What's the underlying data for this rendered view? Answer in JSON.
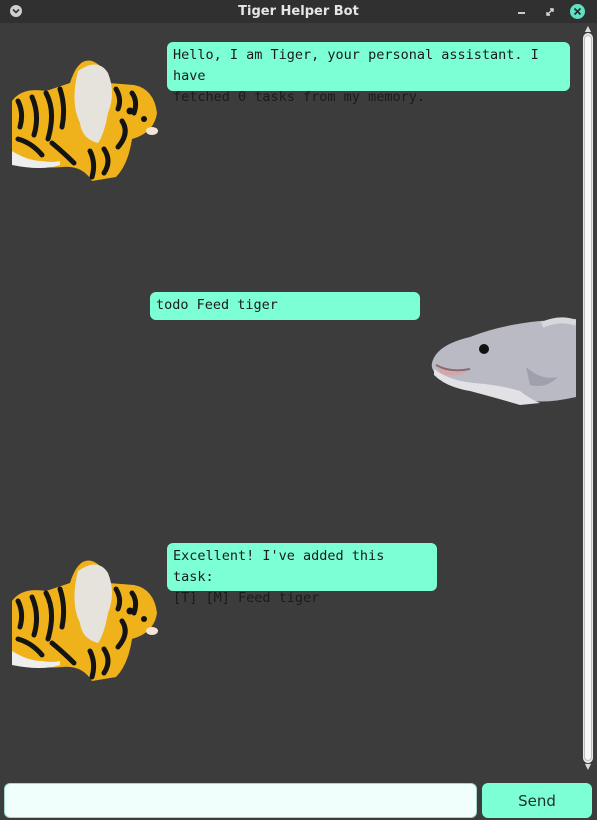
{
  "window": {
    "title": "Tiger Helper Bot",
    "accent": "#7cffd4",
    "background": "#3c3c3c"
  },
  "messages": [
    {
      "sender": "bot",
      "avatar": "tiger-plush",
      "lines": [
        "Hello, I am Tiger, your personal assistant. I have",
        "fetched 0 tasks from my memory."
      ]
    },
    {
      "sender": "user",
      "avatar": "dolphin-plush",
      "lines": [
        "todo Feed tiger"
      ]
    },
    {
      "sender": "bot",
      "avatar": "tiger-plush",
      "lines": [
        "Excellent! I've added this task:",
        "[T] [M] Feed tiger"
      ]
    }
  ],
  "input": {
    "value": "",
    "placeholder": ""
  },
  "send_label": "Send"
}
